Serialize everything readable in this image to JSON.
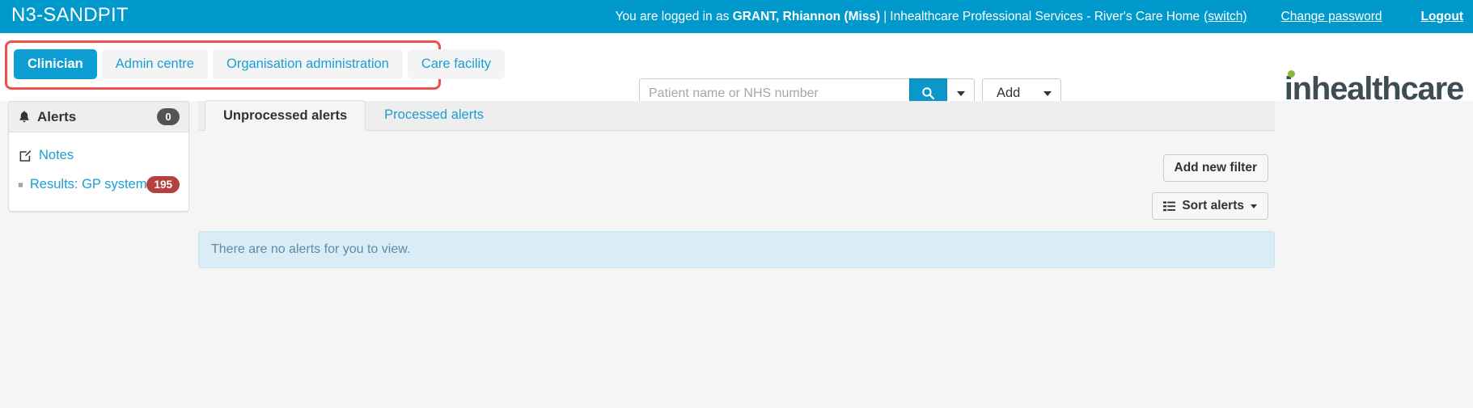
{
  "topbar": {
    "title": "N3-SANDPIT",
    "logged_in_prefix": "You are logged in as ",
    "user_name": "GRANT, Rhiannon (Miss)",
    "separator": "|",
    "organisation": "Inhealthcare Professional Services - River's Care Home",
    "switch_label": "(switch)",
    "change_password_label": "Change password",
    "logout_label": "Logout"
  },
  "nav": {
    "tabs": [
      {
        "label": "Clinician",
        "active": true
      },
      {
        "label": "Admin centre",
        "active": false
      },
      {
        "label": "Organisation administration",
        "active": false
      },
      {
        "label": "Care facility",
        "active": false
      }
    ],
    "highlight_color": "#f0504b"
  },
  "search": {
    "placeholder": "Patient name or NHS number",
    "value": "",
    "search_icon": "magnifier-icon",
    "search_caret_icon": "chevron-down-icon",
    "add_label": "Add",
    "add_caret_icon": "chevron-down-icon"
  },
  "brand": {
    "logo_text": "inhealthcare",
    "logo_color": "#3e4c54",
    "logo_dot_color": "#8cb63c"
  },
  "sidebar": {
    "header": {
      "icon": "bell-icon",
      "title": "Alerts",
      "count": "0"
    },
    "items": [
      {
        "icon": "note-edit-icon",
        "label": "Notes",
        "badge": ""
      },
      {
        "icon": "list-table-icon",
        "label": "Results: GP system",
        "badge": "195"
      }
    ]
  },
  "main": {
    "tabs": [
      {
        "label": "Unprocessed alerts",
        "active": true
      },
      {
        "label": "Processed alerts",
        "active": false
      }
    ],
    "add_filter_label": "Add new filter",
    "sort_alerts_label": "Sort alerts",
    "sort_icon": "list-icon",
    "sort_caret_icon": "caret-down-icon",
    "empty_message": "There are no alerts for you to view."
  }
}
